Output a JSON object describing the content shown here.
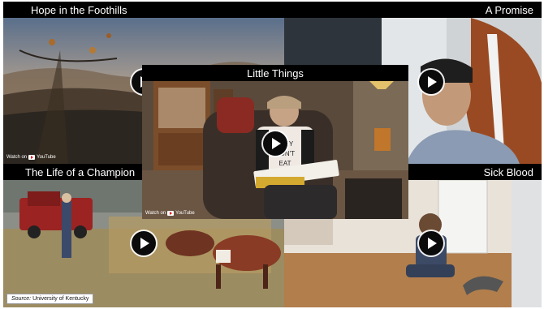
{
  "tiles": {
    "hope": {
      "title": "Hope in the Foothills",
      "watch_label": "Watch on",
      "yt_label": "YouTube"
    },
    "promise": {
      "title": "A Promise"
    },
    "little": {
      "title": "Little Things",
      "watch_label": "Watch on",
      "yt_label": "YouTube"
    },
    "champion": {
      "title": "The Life of a Champion"
    },
    "sick": {
      "title": "Sick Blood"
    }
  },
  "source": {
    "label": "Source:",
    "value": "University of Kentucky"
  },
  "colors": {
    "title_bar": "#000000",
    "play_button": "#0b0b0b",
    "play_ring": "#ffffff"
  }
}
